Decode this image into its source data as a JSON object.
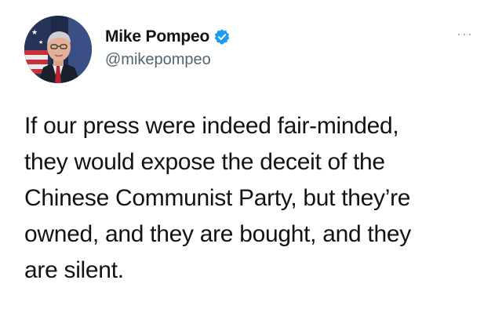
{
  "author": {
    "display_name": "Mike Pompeo",
    "handle": "@mikepompeo",
    "verified_icon": "verified-badge-icon",
    "avatar_icon": "profile-photo"
  },
  "menu": {
    "more_label": "···"
  },
  "tweet": {
    "lines": [
      "If our press were indeed fair-minded,",
      "they would expose the deceit of the",
      "Chinese Communist Party, but they’re",
      "owned, and they are bought, and they",
      "are silent."
    ]
  },
  "colors": {
    "verified_blue": "#1d9bf0",
    "text": "#0f1419",
    "secondary": "#536471"
  }
}
